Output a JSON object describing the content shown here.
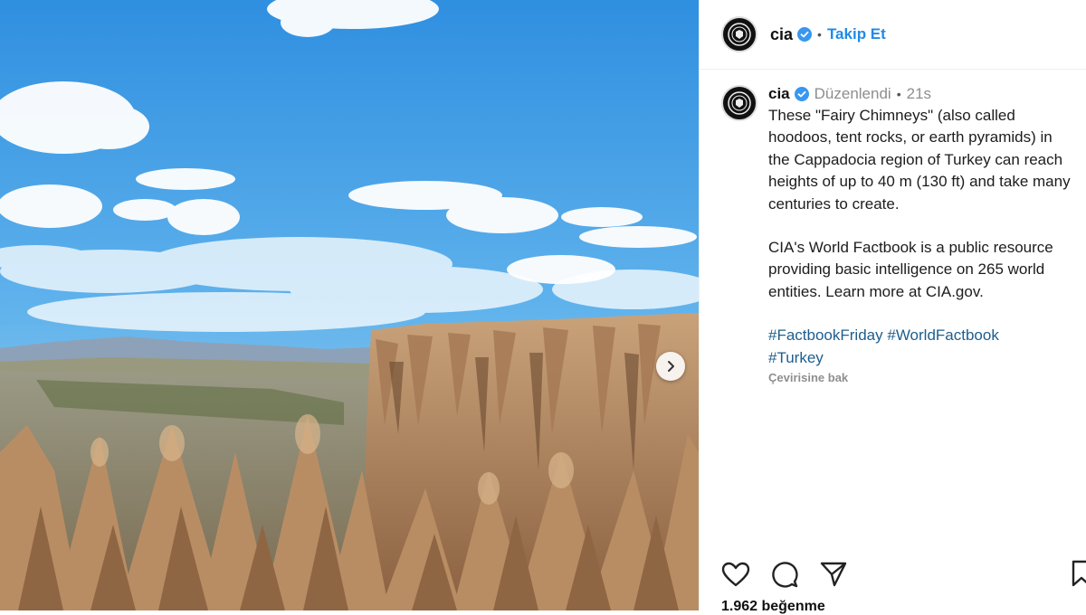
{
  "post": {
    "username": "cia",
    "follow_label": "Takip Et",
    "dot": "•",
    "caption": {
      "username": "cia",
      "edited_label": "Düzenlendi",
      "time_ago": "21s",
      "paragraph1": "These \"Fairy Chimneys\" (also called hoodoos, tent rocks, or earth pyramids) in the Cappadocia region of Turkey can reach heights of up to 40 m (130 ft) and take many centuries to create.",
      "paragraph2": "CIA's World Factbook is a public resource providing basic intelligence on 265 world entities. Learn more at CIA.gov.",
      "hashtags": [
        "#FactbookFriday",
        "#WorldFactbook",
        "#Turkey"
      ],
      "translate_label": "Çevirisine bak"
    },
    "likes_label": "1.962 beğenme"
  },
  "icons": {
    "verified": "verified-badge-icon",
    "next": "chevron-right-icon",
    "like": "heart-icon",
    "comment": "comment-icon",
    "share": "paper-plane-icon",
    "save": "bookmark-icon"
  },
  "colors": {
    "follow": "#1f8be8",
    "hashtag": "#1d5e8e",
    "verified": "#3897f0",
    "muted": "#8e8e8e"
  }
}
